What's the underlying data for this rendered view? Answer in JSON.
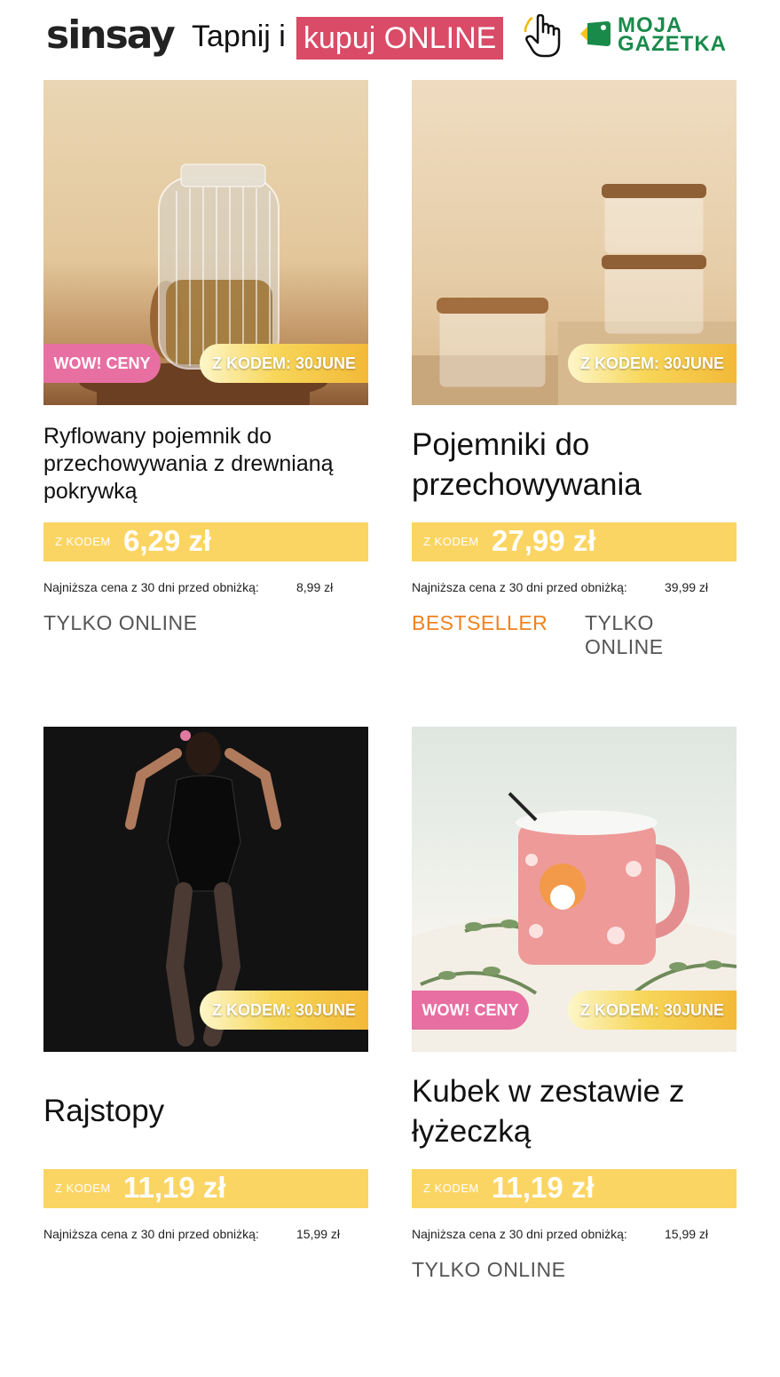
{
  "header": {
    "logo": "sinsay",
    "tap_text": "Tapnij i",
    "tap_highlight": "kupuj ONLINE",
    "gazetka_line1": "MOJA",
    "gazetka_line2": "GAZETKA"
  },
  "badges": {
    "wow": "WOW! CENY",
    "code": "Z KODEM: 30JUNE"
  },
  "price_prefix": "Z KODEM",
  "lowest_label": "Najniższa cena z 30 dni przed obniżką:",
  "products": [
    {
      "title": "Ryflowany pojemnik do przechowywania z drewnianą pokrywką",
      "price": "6,29 zł",
      "lowest_price": "8,99 zł",
      "tags": [
        "TYLKO ONLINE"
      ]
    },
    {
      "title": "Pojemniki do przechowywania",
      "price": "27,99 zł",
      "lowest_price": "39,99 zł",
      "tags": [
        "BESTSELLER",
        "TYLKO ONLINE"
      ]
    },
    {
      "title": "Rajstopy",
      "price": "11,19 zł",
      "lowest_price": "15,99 zł",
      "tags": []
    },
    {
      "title": "Kubek w zestawie z łyżeczką",
      "price": "11,19 zł",
      "lowest_price": "15,99 zł",
      "tags": [
        "TYLKO ONLINE"
      ]
    }
  ],
  "colors": {
    "price_bar": "#fbd563",
    "wow_badge": "#e86fa1",
    "highlight": "#d94b66",
    "bestseller": "#f0821e",
    "gazetka_green": "#1a8a4b"
  }
}
